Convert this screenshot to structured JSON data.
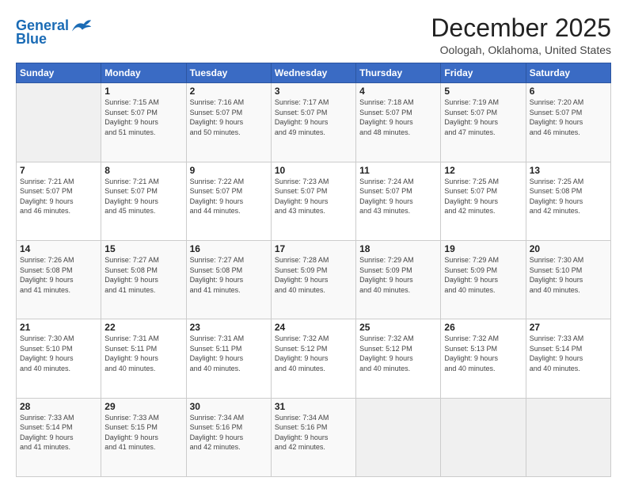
{
  "logo": {
    "line1": "General",
    "line2": "Blue"
  },
  "title": "December 2025",
  "subtitle": "Oologah, Oklahoma, United States",
  "days_header": [
    "Sunday",
    "Monday",
    "Tuesday",
    "Wednesday",
    "Thursday",
    "Friday",
    "Saturday"
  ],
  "weeks": [
    [
      {
        "day": "",
        "info": ""
      },
      {
        "day": "1",
        "info": "Sunrise: 7:15 AM\nSunset: 5:07 PM\nDaylight: 9 hours\nand 51 minutes."
      },
      {
        "day": "2",
        "info": "Sunrise: 7:16 AM\nSunset: 5:07 PM\nDaylight: 9 hours\nand 50 minutes."
      },
      {
        "day": "3",
        "info": "Sunrise: 7:17 AM\nSunset: 5:07 PM\nDaylight: 9 hours\nand 49 minutes."
      },
      {
        "day": "4",
        "info": "Sunrise: 7:18 AM\nSunset: 5:07 PM\nDaylight: 9 hours\nand 48 minutes."
      },
      {
        "day": "5",
        "info": "Sunrise: 7:19 AM\nSunset: 5:07 PM\nDaylight: 9 hours\nand 47 minutes."
      },
      {
        "day": "6",
        "info": "Sunrise: 7:20 AM\nSunset: 5:07 PM\nDaylight: 9 hours\nand 46 minutes."
      }
    ],
    [
      {
        "day": "7",
        "info": "Sunrise: 7:21 AM\nSunset: 5:07 PM\nDaylight: 9 hours\nand 46 minutes."
      },
      {
        "day": "8",
        "info": "Sunrise: 7:21 AM\nSunset: 5:07 PM\nDaylight: 9 hours\nand 45 minutes."
      },
      {
        "day": "9",
        "info": "Sunrise: 7:22 AM\nSunset: 5:07 PM\nDaylight: 9 hours\nand 44 minutes."
      },
      {
        "day": "10",
        "info": "Sunrise: 7:23 AM\nSunset: 5:07 PM\nDaylight: 9 hours\nand 43 minutes."
      },
      {
        "day": "11",
        "info": "Sunrise: 7:24 AM\nSunset: 5:07 PM\nDaylight: 9 hours\nand 43 minutes."
      },
      {
        "day": "12",
        "info": "Sunrise: 7:25 AM\nSunset: 5:07 PM\nDaylight: 9 hours\nand 42 minutes."
      },
      {
        "day": "13",
        "info": "Sunrise: 7:25 AM\nSunset: 5:08 PM\nDaylight: 9 hours\nand 42 minutes."
      }
    ],
    [
      {
        "day": "14",
        "info": "Sunrise: 7:26 AM\nSunset: 5:08 PM\nDaylight: 9 hours\nand 41 minutes."
      },
      {
        "day": "15",
        "info": "Sunrise: 7:27 AM\nSunset: 5:08 PM\nDaylight: 9 hours\nand 41 minutes."
      },
      {
        "day": "16",
        "info": "Sunrise: 7:27 AM\nSunset: 5:08 PM\nDaylight: 9 hours\nand 41 minutes."
      },
      {
        "day": "17",
        "info": "Sunrise: 7:28 AM\nSunset: 5:09 PM\nDaylight: 9 hours\nand 40 minutes."
      },
      {
        "day": "18",
        "info": "Sunrise: 7:29 AM\nSunset: 5:09 PM\nDaylight: 9 hours\nand 40 minutes."
      },
      {
        "day": "19",
        "info": "Sunrise: 7:29 AM\nSunset: 5:09 PM\nDaylight: 9 hours\nand 40 minutes."
      },
      {
        "day": "20",
        "info": "Sunrise: 7:30 AM\nSunset: 5:10 PM\nDaylight: 9 hours\nand 40 minutes."
      }
    ],
    [
      {
        "day": "21",
        "info": "Sunrise: 7:30 AM\nSunset: 5:10 PM\nDaylight: 9 hours\nand 40 minutes."
      },
      {
        "day": "22",
        "info": "Sunrise: 7:31 AM\nSunset: 5:11 PM\nDaylight: 9 hours\nand 40 minutes."
      },
      {
        "day": "23",
        "info": "Sunrise: 7:31 AM\nSunset: 5:11 PM\nDaylight: 9 hours\nand 40 minutes."
      },
      {
        "day": "24",
        "info": "Sunrise: 7:32 AM\nSunset: 5:12 PM\nDaylight: 9 hours\nand 40 minutes."
      },
      {
        "day": "25",
        "info": "Sunrise: 7:32 AM\nSunset: 5:12 PM\nDaylight: 9 hours\nand 40 minutes."
      },
      {
        "day": "26",
        "info": "Sunrise: 7:32 AM\nSunset: 5:13 PM\nDaylight: 9 hours\nand 40 minutes."
      },
      {
        "day": "27",
        "info": "Sunrise: 7:33 AM\nSunset: 5:14 PM\nDaylight: 9 hours\nand 40 minutes."
      }
    ],
    [
      {
        "day": "28",
        "info": "Sunrise: 7:33 AM\nSunset: 5:14 PM\nDaylight: 9 hours\nand 41 minutes."
      },
      {
        "day": "29",
        "info": "Sunrise: 7:33 AM\nSunset: 5:15 PM\nDaylight: 9 hours\nand 41 minutes."
      },
      {
        "day": "30",
        "info": "Sunrise: 7:34 AM\nSunset: 5:16 PM\nDaylight: 9 hours\nand 42 minutes."
      },
      {
        "day": "31",
        "info": "Sunrise: 7:34 AM\nSunset: 5:16 PM\nDaylight: 9 hours\nand 42 minutes."
      },
      {
        "day": "",
        "info": ""
      },
      {
        "day": "",
        "info": ""
      },
      {
        "day": "",
        "info": ""
      }
    ]
  ]
}
